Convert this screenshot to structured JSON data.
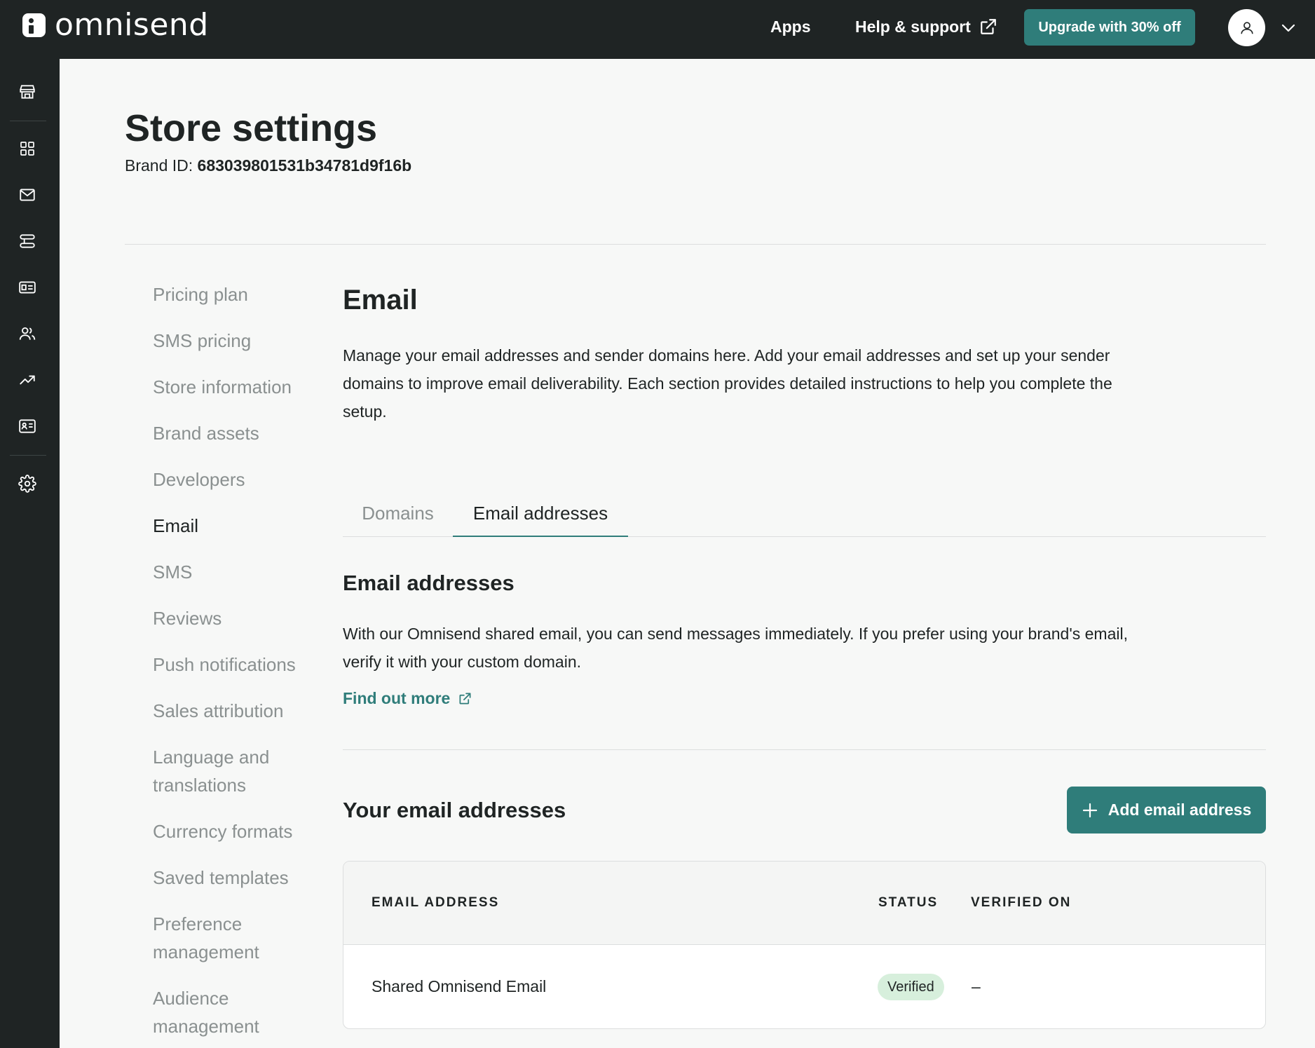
{
  "header": {
    "logo_text": "omnisend",
    "apps_label": "Apps",
    "help_label": "Help & support",
    "upgrade_label": "Upgrade with 30% off"
  },
  "sidebar": {
    "icons": [
      "store-icon",
      "grid-icon",
      "mail-icon",
      "automation-icon",
      "forms-icon",
      "audience-icon",
      "reports-icon",
      "contact-card-icon",
      "gear-icon"
    ]
  },
  "page": {
    "title": "Store settings",
    "brand_id_label": "Brand ID: ",
    "brand_id_value": "683039801531b34781d9f16b"
  },
  "settings_nav": {
    "items": [
      {
        "label": "Pricing plan"
      },
      {
        "label": "SMS pricing"
      },
      {
        "label": "Store information"
      },
      {
        "label": "Brand assets"
      },
      {
        "label": "Developers"
      },
      {
        "label": "Email"
      },
      {
        "label": "SMS"
      },
      {
        "label": "Reviews"
      },
      {
        "label": "Push notifications"
      },
      {
        "label": "Sales attribution"
      },
      {
        "label": "Language and"
      },
      {
        "label": "translations"
      },
      {
        "label": "Currency formats"
      },
      {
        "label": "Saved templates"
      },
      {
        "label": "Preference"
      },
      {
        "label": "management"
      },
      {
        "label": "Audience"
      },
      {
        "label": "management"
      }
    ],
    "active": "Email"
  },
  "email_section": {
    "title": "Email",
    "description": "Manage your email addresses and sender domains here. Add your email addresses and set up your sender domains to improve email deliverability. Each section provides detailed instructions to help you complete the setup.",
    "tabs": [
      {
        "label": "Domains"
      },
      {
        "label": "Email addresses"
      }
    ],
    "active_tab": "Email addresses"
  },
  "email_addresses": {
    "title": "Email addresses",
    "description": "With our Omnisend shared email, you can send messages immediately. If you prefer using your brand's email, verify it with your custom domain.",
    "find_more_label": "Find out more",
    "list_title": "Your email addresses",
    "add_button_label": "Add email address",
    "table": {
      "columns": [
        "EMAIL ADDRESS",
        "STATUS",
        "VERIFIED ON"
      ],
      "rows": [
        {
          "email": "Shared Omnisend Email",
          "status": "Verified",
          "verified_on": "–"
        }
      ]
    }
  },
  "colors": {
    "topbar": "#1f2424",
    "accent": "#2f7d7a",
    "badge_verified": "#d7efdc"
  }
}
